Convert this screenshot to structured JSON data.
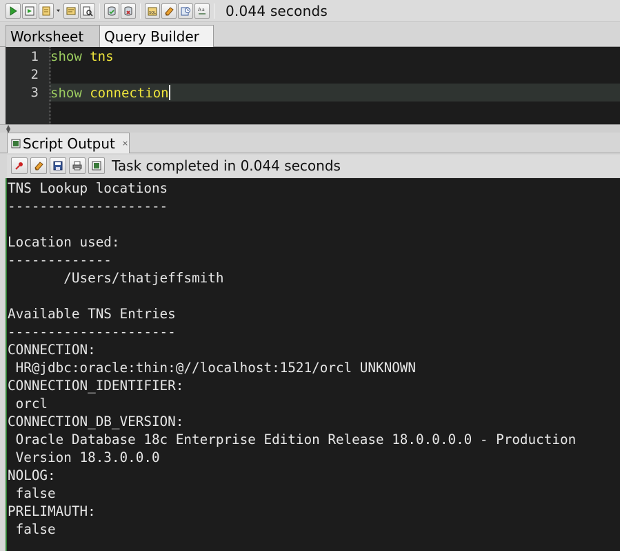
{
  "toolbar": {
    "timing": "0.044 seconds",
    "buttons": [
      {
        "name": "run-statement-icon",
        "color": "#2e9e2e"
      },
      {
        "name": "run-script-icon",
        "color": "#2e9e2e"
      },
      {
        "name": "autotrace-icon",
        "color": "#b07820"
      },
      {
        "name": "explain-plan-icon",
        "color": "#b07820"
      },
      {
        "name": "sql-tuning-icon",
        "color": "#5a6a7a"
      },
      {
        "name": "commit-icon",
        "color": "#2e9e2e"
      },
      {
        "name": "rollback-icon",
        "color": "#c03030"
      },
      {
        "name": "unshared-sql-icon",
        "color": "#b07820"
      },
      {
        "name": "clear-eraser-icon",
        "color": "#d08a20"
      },
      {
        "name": "sql-history-icon",
        "color": "#3a6ab0"
      },
      {
        "name": "format-case-icon",
        "color": "#3a6a3a"
      }
    ]
  },
  "tabs": {
    "worksheet": "Worksheet",
    "query_builder": "Query Builder"
  },
  "editor": {
    "lines": [
      {
        "number": "1",
        "keyword": "show",
        "arg": "tns"
      },
      {
        "number": "2",
        "keyword": "",
        "arg": ""
      },
      {
        "number": "3",
        "keyword": "show",
        "arg": "connection"
      }
    ]
  },
  "output_panel": {
    "tab_label": "Script Output",
    "close": "×",
    "status": "Task completed in 0.044 seconds",
    "buttons": [
      {
        "name": "pin-icon",
        "color": "#cc2222"
      },
      {
        "name": "clear-eraser-icon",
        "color": "#d08a20"
      },
      {
        "name": "save-icon",
        "color": "#3a5a9a"
      },
      {
        "name": "print-icon",
        "color": "#555555"
      },
      {
        "name": "buffer-size-icon",
        "color": "#3a7a3a"
      }
    ],
    "lines": [
      "TNS Lookup locations",
      "--------------------",
      "",
      "Location used:",
      "-------------",
      "       /Users/thatjeffsmith",
      "",
      "Available TNS Entries",
      "---------------------",
      "CONNECTION:",
      " HR@jdbc:oracle:thin:@//localhost:1521/orcl UNKNOWN",
      "CONNECTION_IDENTIFIER:",
      " orcl",
      "CONNECTION_DB_VERSION:",
      " Oracle Database 18c Enterprise Edition Release 18.0.0.0.0 - Production",
      " Version 18.3.0.0.0",
      "NOLOG:",
      " false",
      "PRELIMAUTH:",
      " false"
    ]
  }
}
